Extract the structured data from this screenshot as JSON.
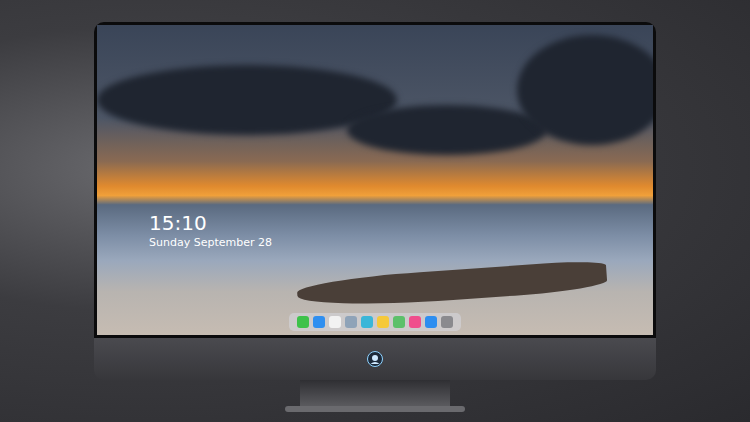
{
  "lock_screen": {
    "time": "15:10",
    "date": "Sunday September 28"
  },
  "dock": {
    "items": [
      {
        "color": "#3ec24a"
      },
      {
        "color": "#2f8ff0"
      },
      {
        "color": "#f2f2f2"
      },
      {
        "color": "#8fa3b8"
      },
      {
        "color": "#3ab6d8"
      },
      {
        "color": "#f5c93a"
      },
      {
        "color": "#5cc06a"
      },
      {
        "color": "#f04e8c"
      },
      {
        "color": "#2d8ef0"
      },
      {
        "color": "#8a8a8e"
      }
    ]
  }
}
